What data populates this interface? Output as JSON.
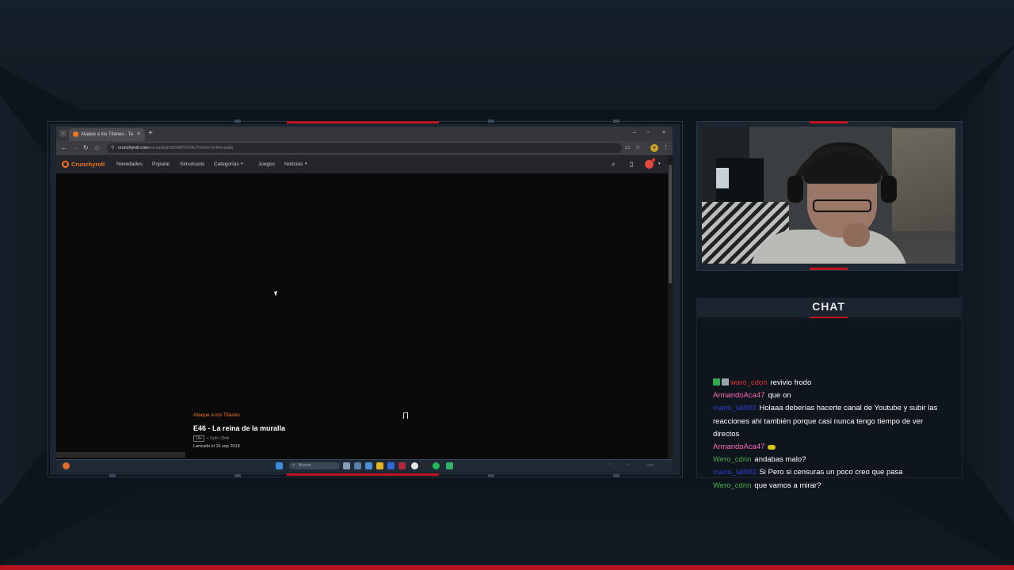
{
  "colors": {
    "accent_red": "#c0141f",
    "crunchyroll_orange": "#f47521",
    "chat_user_red": "#e0333a",
    "chat_user_pink": "#ff69b4",
    "chat_user_green": "#4caf50",
    "chat_user_blue": "#2b3fd0"
  },
  "browser": {
    "tab_title": "Ataque a los Titanes - Tercera",
    "tab_close": "×",
    "new_tab": "+",
    "window_controls": [
      "–",
      "▫",
      "×"
    ],
    "url_host": "crunchyroll.com",
    "url_path": "/es-es/watch/G6RVV0NJY/ruler-of-the-walls"
  },
  "crunchyroll": {
    "logo": "Crunchyroll",
    "nav": [
      "Novedades",
      "Popular",
      "Simulcasts",
      "Categorías",
      "Juegos",
      "Noticias"
    ],
    "episode": {
      "series": "Ataque a los Titanes",
      "title": "E46 - La reina de la muralla",
      "rating": "16+",
      "audio": "• Sub | Dob",
      "release": "Lanzado el 16 sep 2018"
    }
  },
  "taskbar": {
    "search_placeholder": "Buscar"
  },
  "chat": {
    "title": "CHAT",
    "messages": [
      {
        "user": "waro_cdon",
        "text": "revivio frodo",
        "color": "#e0333a",
        "badges": [
          "green",
          "gray"
        ]
      },
      {
        "user": "ArmandoAca47",
        "text": "que on",
        "color": "#ff69b4",
        "badges": []
      },
      {
        "user": "mario_lal983",
        "text": "Holaaa deberías hacerte canal de Youtube y subir las reacciones ahí también porque casi nunca tengo tiempo de ver directos",
        "color": "#2b3fd0",
        "badges": []
      },
      {
        "user": "ArmandoAca47",
        "text": "",
        "color": "#ff69b4",
        "badges": [],
        "emote": true
      },
      {
        "user": "Wero_cdnn",
        "text": "andabas malo?",
        "color": "#4caf50",
        "badges": []
      },
      {
        "user": "mario_lal983",
        "text": "Si Pero si censuras un poco creo que pasa",
        "color": "#2b3fd0",
        "badges": []
      },
      {
        "user": "Wero_cdnn",
        "text": "que vamos a mirar?",
        "color": "#4caf50",
        "badges": []
      }
    ]
  }
}
